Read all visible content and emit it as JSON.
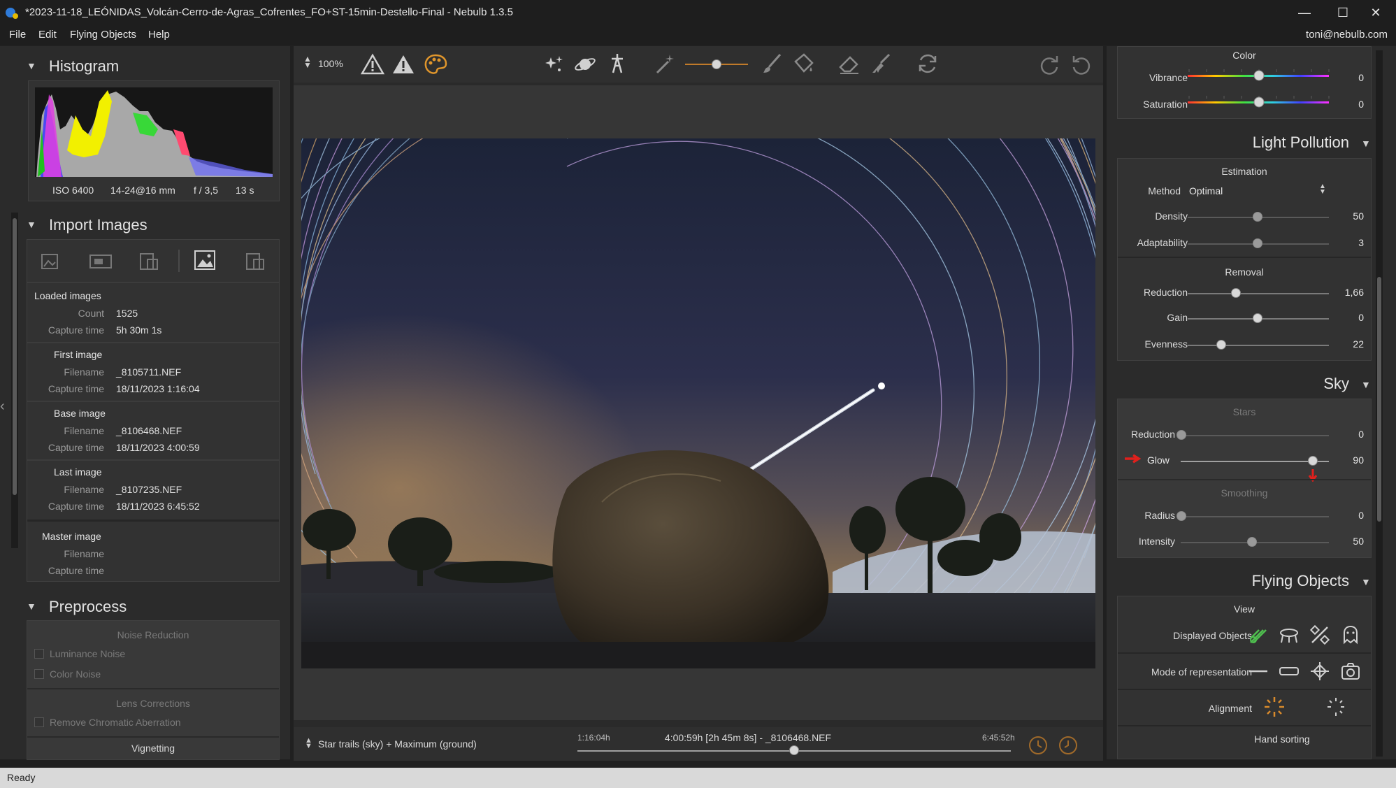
{
  "window": {
    "title": "*2023-11-18_LEÓNIDAS_Volcán-Cerro-de-Agras_Cofrentes_FO+ST-15min-Destello-Final - Nebulb 1.3.5",
    "minimize": "—",
    "maximize": "☐",
    "close": "✕"
  },
  "menu": {
    "items": [
      "File",
      "Edit",
      "Flying Objects",
      "Help"
    ],
    "account": "toni@nebulb.com"
  },
  "histogram": {
    "title": "Histogram",
    "iso": "ISO 6400",
    "lens": "14-24@16 mm",
    "aperture": "f / 3,5",
    "exposure": "13 s"
  },
  "import": {
    "title": "Import Images",
    "loaded_label": "Loaded images",
    "count_label": "Count",
    "count": "1525",
    "capture_label": "Capture time",
    "capture_total": "5h 30m 1s",
    "filename_label": "Filename",
    "first_label": "First image",
    "first_file": "_8105711.NEF",
    "first_time": "18/11/2023 1:16:04",
    "base_label": "Base image",
    "base_file": "_8106468.NEF",
    "base_time": "18/11/2023 4:00:59",
    "last_label": "Last image",
    "last_file": "_8107235.NEF",
    "last_time": "18/11/2023 6:45:52",
    "master_label": "Master image"
  },
  "preprocess": {
    "title": "Preprocess",
    "noise_reduction": "Noise Reduction",
    "luminance_noise": "Luminance Noise",
    "color_noise": "Color Noise",
    "lens_corrections": "Lens Corrections",
    "remove_ca": "Remove Chromatic Aberration",
    "vignetting": "Vignetting"
  },
  "toolbar": {
    "zoom": "100%"
  },
  "bottombar": {
    "mode": "Star trails (sky) + Maximum (ground)",
    "start_time": "1:16:04h",
    "current": "4:00:59h [2h 45m 8s] - _8106468.NEF",
    "end_time": "6:45:52h",
    "timeline_position": 0.5
  },
  "color": {
    "title": "Color",
    "vibrance_label": "Vibrance",
    "vibrance": "0",
    "saturation_label": "Saturation",
    "saturation": "0"
  },
  "light_pollution": {
    "title": "Light Pollution",
    "estimation": "Estimation",
    "method_label": "Method",
    "method": "Optimal",
    "density_label": "Density",
    "density": "50",
    "adaptability_label": "Adaptability",
    "adaptability": "3",
    "removal": "Removal",
    "reduction_label": "Reduction",
    "reduction": "1,66",
    "gain_label": "Gain",
    "gain": "0",
    "evenness_label": "Evenness",
    "evenness": "22"
  },
  "sky": {
    "title": "Sky",
    "stars": "Stars",
    "reduction_label": "Reduction",
    "reduction": "0",
    "glow_label": "Glow",
    "glow": "90",
    "smoothing": "Smoothing",
    "radius_label": "Radius",
    "radius": "0",
    "intensity_label": "Intensity",
    "intensity": "50"
  },
  "flying_objects": {
    "title": "Flying Objects",
    "view": "View",
    "displayed_label": "Displayed Objects",
    "mode_label": "Mode of representation",
    "alignment_label": "Alignment",
    "hand_sorting": "Hand sorting"
  },
  "status": {
    "text": "Ready"
  },
  "colors": {
    "accent_orange": "#d88a2c",
    "marker_red": "#e0201c",
    "ok_green": "#4fc04f"
  }
}
